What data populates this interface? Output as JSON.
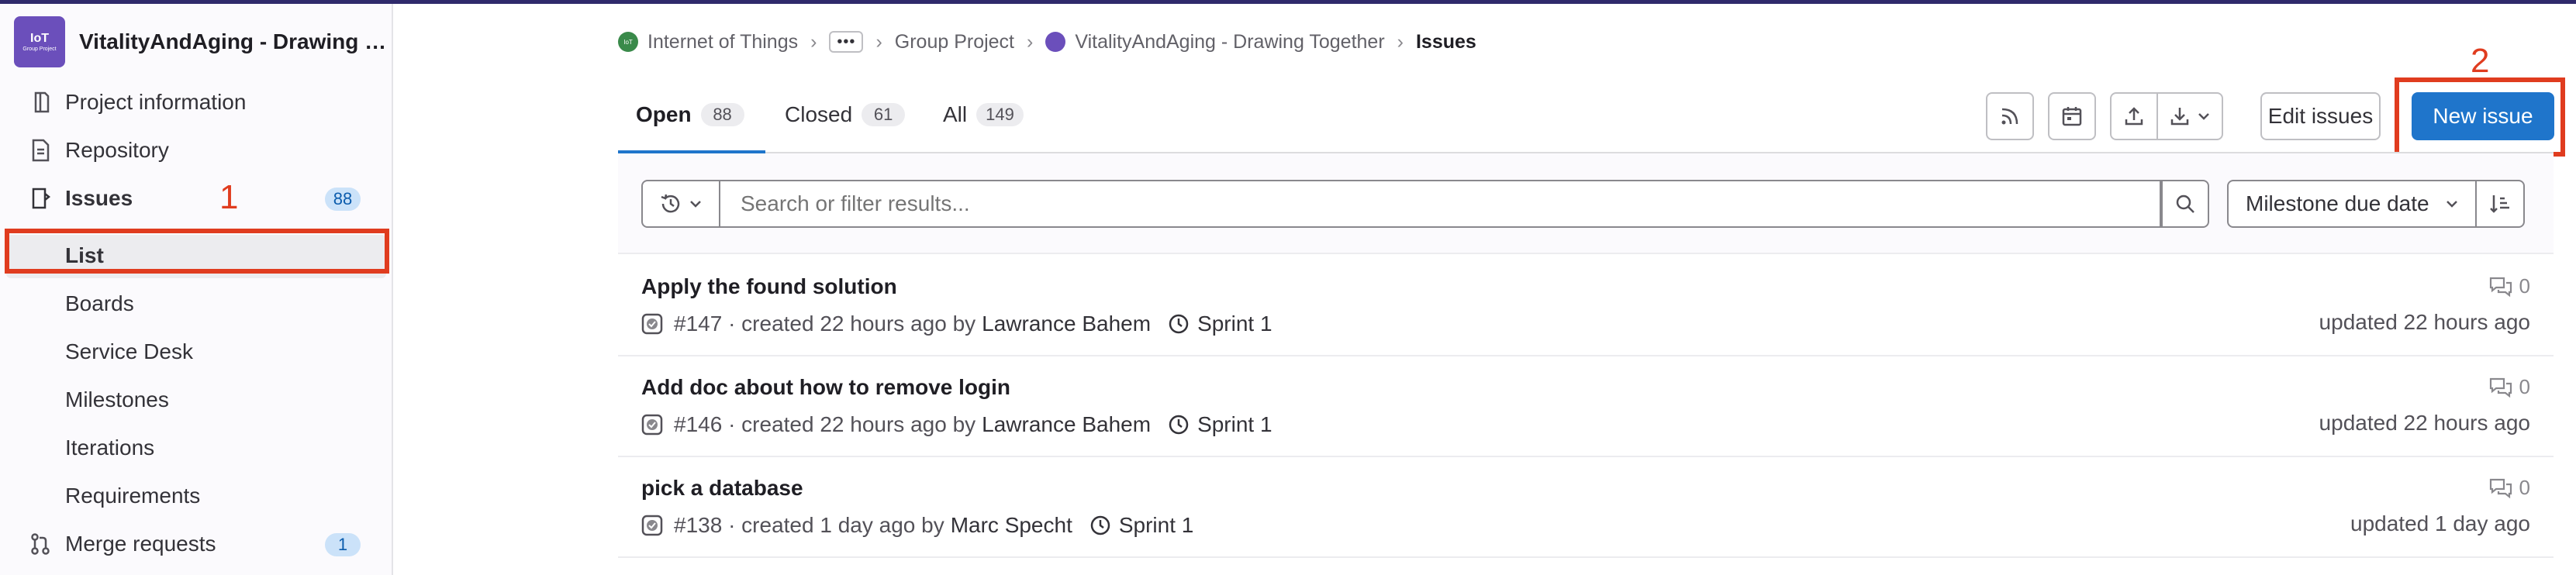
{
  "sidebar": {
    "project_avatar_line1": "IoT",
    "project_avatar_line2": "Group Project",
    "project_name": "VitalityAndAging - Drawing Together",
    "items": [
      {
        "label": "Project information",
        "icon": "info-icon"
      },
      {
        "label": "Repository",
        "icon": "doc-icon"
      },
      {
        "label": "Issues",
        "icon": "issues-icon",
        "count": "88"
      },
      {
        "label": "List"
      },
      {
        "label": "Boards"
      },
      {
        "label": "Service Desk"
      },
      {
        "label": "Milestones"
      },
      {
        "label": "Iterations"
      },
      {
        "label": "Requirements"
      },
      {
        "label": "Merge requests",
        "icon": "merge-request-icon",
        "count": "1"
      }
    ]
  },
  "annotations": {
    "one": "1",
    "two": "2",
    "color": "#e03c1f"
  },
  "breadcrumb": {
    "group": "Internet of Things",
    "group_avatar": "IoT",
    "ellipsis": "•••",
    "subgroup": "Group Project",
    "project": "VitalityAndAging - Drawing Together",
    "current": "Issues"
  },
  "tabs": [
    {
      "label": "Open",
      "count": "88"
    },
    {
      "label": "Closed",
      "count": "61"
    },
    {
      "label": "All",
      "count": "149"
    }
  ],
  "toolbar": {
    "edit_issues": "Edit issues",
    "new_issue": "New issue",
    "icons": [
      "rss-icon",
      "calendar-icon",
      "upload-icon",
      "download-icon"
    ]
  },
  "filter": {
    "search_placeholder": "Search or filter results...",
    "sort_label": "Milestone due date"
  },
  "issues": [
    {
      "title": "Apply the found solution",
      "meta": "#147 · created 22 hours ago by",
      "author": "Lawrance Bahem",
      "milestone": "Sprint 1",
      "comments": "0",
      "updated": "updated 22 hours ago"
    },
    {
      "title": "Add doc about how to remove login",
      "meta": "#146 · created 22 hours ago by",
      "author": "Lawrance Bahem",
      "milestone": "Sprint 1",
      "comments": "0",
      "updated": "updated 22 hours ago"
    },
    {
      "title": "pick a database",
      "meta": "#138 · created 1 day ago by",
      "author": "Marc Specht",
      "milestone": "Sprint 1",
      "comments": "0",
      "updated": "updated 1 day ago"
    }
  ],
  "colors": {
    "accent": "#1f75cb",
    "project_avatar": "#6b4fbb",
    "annotation": "#e03c1f"
  }
}
